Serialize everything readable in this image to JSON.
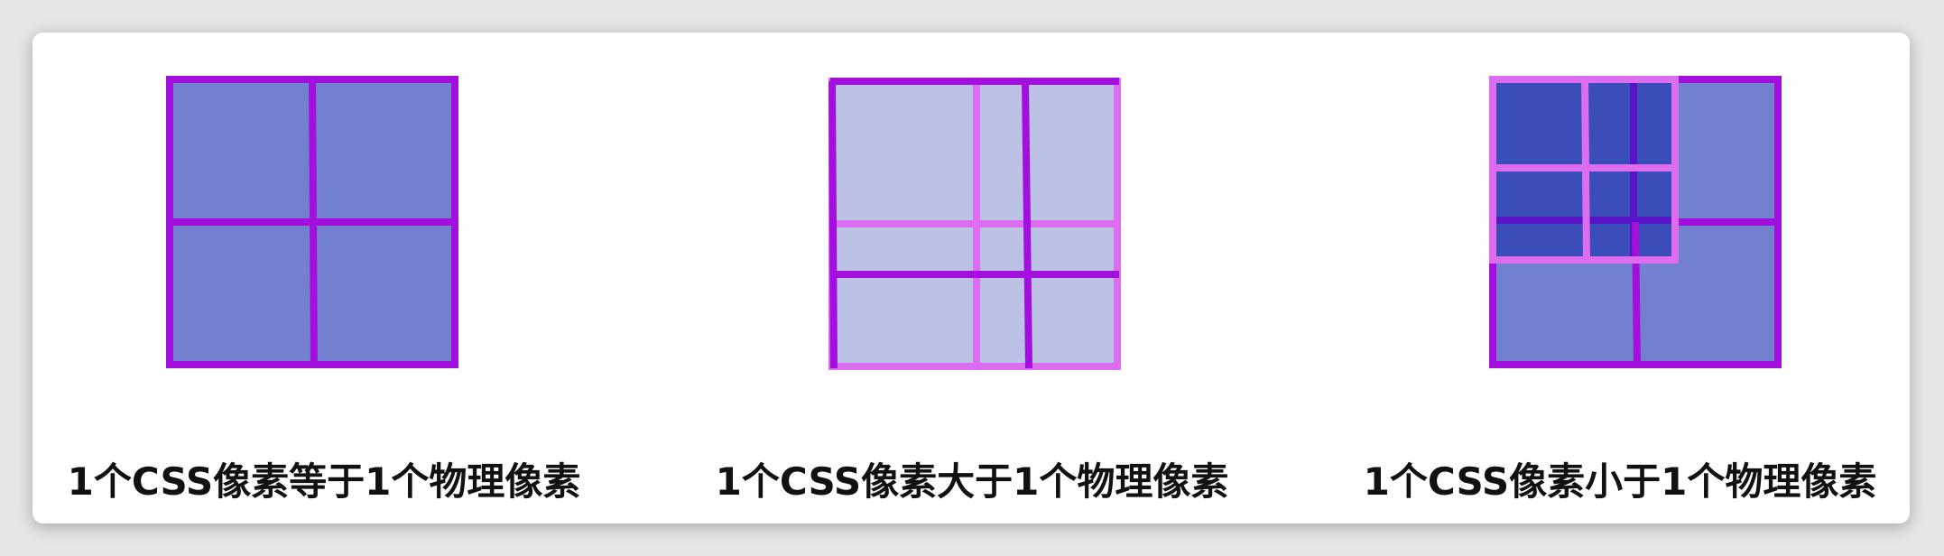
{
  "colors": {
    "grid_line": "#a30fdd",
    "light_grid_line": "#dc6df0",
    "fill_mid": "#7380cf",
    "fill_light": "#bcc1e6",
    "fill_dark": "#3a4db8",
    "line_dark": "#5a14c8",
    "caption": "#111111",
    "background": "#e6e6e6",
    "card": "#ffffff"
  },
  "panels": [
    {
      "caption": "1个CSS像素等于1个物理像素"
    },
    {
      "caption": "1个CSS像素大于1个物理像素"
    },
    {
      "caption": "1个CSS像素小于1个物理像素"
    }
  ]
}
